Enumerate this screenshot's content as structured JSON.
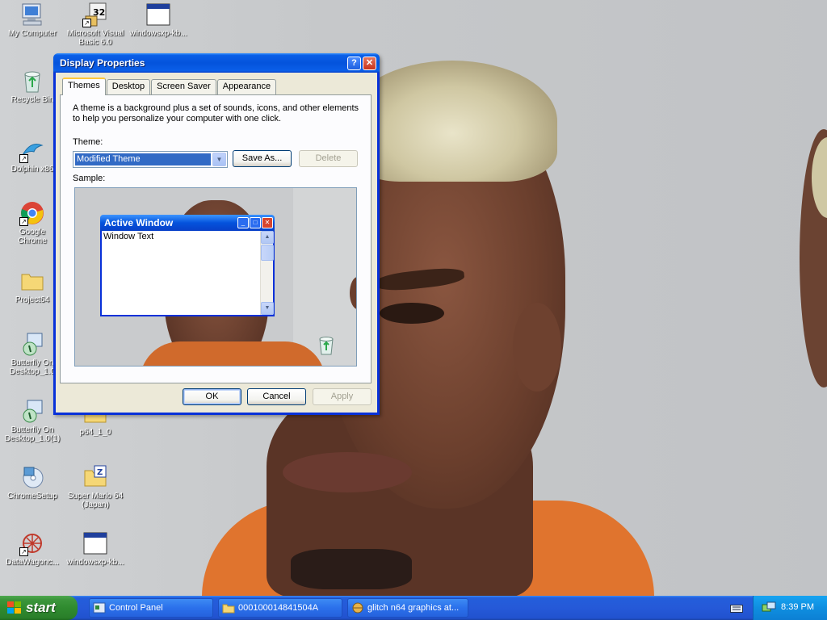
{
  "desktop": {
    "icons": [
      {
        "id": "my-computer",
        "label": "My Computer"
      },
      {
        "id": "vb6",
        "label_line1": "Microsoft Visual",
        "label_line2": "Basic 6.0"
      },
      {
        "id": "windowsxp-kb-1",
        "label": "windowsxp-kb..."
      },
      {
        "id": "recycle-bin",
        "label": "Recycle Bin"
      },
      {
        "id": "dolphin",
        "label": "Dolphin x86"
      },
      {
        "id": "google-chrome",
        "label_line1": "Google",
        "label_line2": "Chrome"
      },
      {
        "id": "project64",
        "label": "Project64"
      },
      {
        "id": "butterfly-1",
        "label_line1": "Butterfly On",
        "label_line2": "Desktop_1.0"
      },
      {
        "id": "butterfly-2",
        "label_line1": "Butterfly On",
        "label_line2": "Desktop_1.0(1)"
      },
      {
        "id": "p64",
        "label": "p64_1_0"
      },
      {
        "id": "chromesetup",
        "label": "ChromeSetup"
      },
      {
        "id": "super-mario",
        "label_line1": "Super Mario 64",
        "label_line2": "(Japan)"
      },
      {
        "id": "datawagon",
        "label": "DataWagonc..."
      },
      {
        "id": "windowsxp-kb-2",
        "label": "windowsxp-kb..."
      }
    ]
  },
  "dialog": {
    "title": "Display Properties",
    "help_glyph": "?",
    "close_glyph": "✕",
    "tabs": [
      "Themes",
      "Desktop",
      "Screen Saver",
      "Appearance"
    ],
    "description": "A theme is a background plus a set of sounds, icons, and other elements to help you personalize your computer with one click.",
    "theme_label": "Theme:",
    "theme_value": "Modified Theme",
    "save_as_label": "Save As...",
    "delete_label": "Delete",
    "sample_label": "Sample:",
    "sample": {
      "window_title": "Active Window",
      "window_text": "Window Text"
    },
    "ok_label": "OK",
    "cancel_label": "Cancel",
    "apply_label": "Apply"
  },
  "taskbar": {
    "start_label": "start",
    "tasks": [
      "Control Panel",
      "000100014841504A",
      "glitch n64 graphics at..."
    ],
    "clock": "8:39 PM"
  },
  "colors": {
    "xp_blue": "#0831d9",
    "start_green": "#2f8b2f",
    "selection": "#316ac5"
  }
}
